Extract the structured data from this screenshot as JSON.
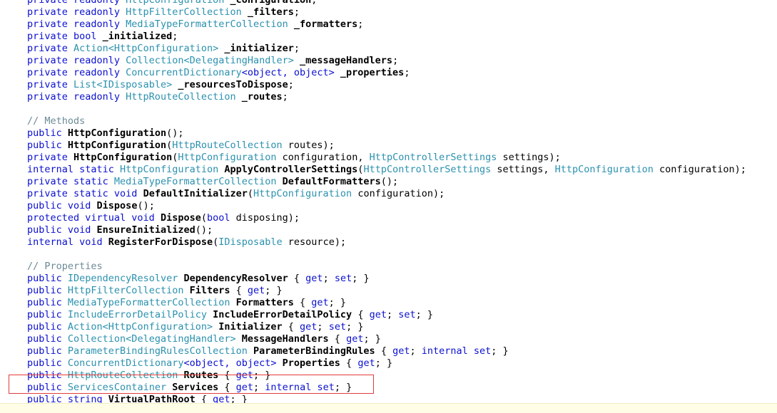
{
  "colors": {
    "keyword": "#0b10cf",
    "type": "#2b91af",
    "comment": "#6c8a96",
    "text": "#000000",
    "highlight_border": "#e23b3b",
    "status_bar": "#fffde6"
  },
  "lines": [
    [
      {
        "t": "kw",
        "v": "private readonly "
      },
      {
        "t": "type",
        "v": "HttpConfiguration "
      },
      {
        "t": "bold",
        "v": "_configuration"
      },
      {
        "t": "txt",
        "v": ";"
      }
    ],
    [
      {
        "t": "kw",
        "v": "private readonly "
      },
      {
        "t": "type",
        "v": "HttpFilterCollection "
      },
      {
        "t": "bold",
        "v": "_filters"
      },
      {
        "t": "txt",
        "v": ";"
      }
    ],
    [
      {
        "t": "kw",
        "v": "private readonly "
      },
      {
        "t": "type",
        "v": "MediaTypeFormatterCollection "
      },
      {
        "t": "bold",
        "v": "_formatters"
      },
      {
        "t": "txt",
        "v": ";"
      }
    ],
    [
      {
        "t": "kw",
        "v": "private bool "
      },
      {
        "t": "bold",
        "v": "_initialized"
      },
      {
        "t": "txt",
        "v": ";"
      }
    ],
    [
      {
        "t": "kw",
        "v": "private "
      },
      {
        "t": "type",
        "v": "Action<HttpConfiguration> "
      },
      {
        "t": "bold",
        "v": "_initializer"
      },
      {
        "t": "txt",
        "v": ";"
      }
    ],
    [
      {
        "t": "kw",
        "v": "private readonly "
      },
      {
        "t": "type",
        "v": "Collection<DelegatingHandler> "
      },
      {
        "t": "bold",
        "v": "_messageHandlers"
      },
      {
        "t": "txt",
        "v": ";"
      }
    ],
    [
      {
        "t": "kw",
        "v": "private readonly "
      },
      {
        "t": "type",
        "v": "ConcurrentDictionary"
      },
      {
        "t": "kw",
        "v": "<object, object> "
      },
      {
        "t": "bold",
        "v": "_properties"
      },
      {
        "t": "txt",
        "v": ";"
      }
    ],
    [
      {
        "t": "kw",
        "v": "private "
      },
      {
        "t": "type",
        "v": "List<IDisposable> "
      },
      {
        "t": "bold",
        "v": "_resourcesToDispose"
      },
      {
        "t": "txt",
        "v": ";"
      }
    ],
    [
      {
        "t": "kw",
        "v": "private readonly "
      },
      {
        "t": "type",
        "v": "HttpRouteCollection "
      },
      {
        "t": "bold",
        "v": "_routes"
      },
      {
        "t": "txt",
        "v": ";"
      }
    ],
    [],
    [
      {
        "t": "cm",
        "v": "// Methods"
      }
    ],
    [
      {
        "t": "kw",
        "v": "public "
      },
      {
        "t": "bold",
        "v": "HttpConfiguration"
      },
      {
        "t": "txt",
        "v": "();"
      }
    ],
    [
      {
        "t": "kw",
        "v": "public "
      },
      {
        "t": "bold",
        "v": "HttpConfiguration"
      },
      {
        "t": "txt",
        "v": "("
      },
      {
        "t": "type",
        "v": "HttpRouteCollection "
      },
      {
        "t": "txt",
        "v": "routes);"
      }
    ],
    [
      {
        "t": "kw",
        "v": "private "
      },
      {
        "t": "bold",
        "v": "HttpConfiguration"
      },
      {
        "t": "txt",
        "v": "("
      },
      {
        "t": "type",
        "v": "HttpConfiguration "
      },
      {
        "t": "txt",
        "v": "configuration, "
      },
      {
        "t": "type",
        "v": "HttpControllerSettings "
      },
      {
        "t": "txt",
        "v": "settings);"
      }
    ],
    [
      {
        "t": "kw",
        "v": "internal static "
      },
      {
        "t": "type",
        "v": "HttpConfiguration "
      },
      {
        "t": "bold",
        "v": "ApplyControllerSettings"
      },
      {
        "t": "txt",
        "v": "("
      },
      {
        "t": "type",
        "v": "HttpControllerSettings "
      },
      {
        "t": "txt",
        "v": "settings, "
      },
      {
        "t": "type",
        "v": "HttpConfiguration "
      },
      {
        "t": "txt",
        "v": "configuration);"
      }
    ],
    [
      {
        "t": "kw",
        "v": "private static "
      },
      {
        "t": "type",
        "v": "MediaTypeFormatterCollection "
      },
      {
        "t": "bold",
        "v": "DefaultFormatters"
      },
      {
        "t": "txt",
        "v": "();"
      }
    ],
    [
      {
        "t": "kw",
        "v": "private static void "
      },
      {
        "t": "bold",
        "v": "DefaultInitializer"
      },
      {
        "t": "txt",
        "v": "("
      },
      {
        "t": "type",
        "v": "HttpConfiguration "
      },
      {
        "t": "txt",
        "v": "configuration);"
      }
    ],
    [
      {
        "t": "kw",
        "v": "public void "
      },
      {
        "t": "bold",
        "v": "Dispose"
      },
      {
        "t": "txt",
        "v": "();"
      }
    ],
    [
      {
        "t": "kw",
        "v": "protected virtual void "
      },
      {
        "t": "bold",
        "v": "Dispose"
      },
      {
        "t": "txt",
        "v": "("
      },
      {
        "t": "kw",
        "v": "bool "
      },
      {
        "t": "txt",
        "v": "disposing);"
      }
    ],
    [
      {
        "t": "kw",
        "v": "public void "
      },
      {
        "t": "bold",
        "v": "EnsureInitialized"
      },
      {
        "t": "txt",
        "v": "();"
      }
    ],
    [
      {
        "t": "kw",
        "v": "internal void "
      },
      {
        "t": "bold",
        "v": "RegisterForDispose"
      },
      {
        "t": "txt",
        "v": "("
      },
      {
        "t": "type",
        "v": "IDisposable "
      },
      {
        "t": "txt",
        "v": "resource);"
      }
    ],
    [],
    [
      {
        "t": "cm",
        "v": "// Properties"
      }
    ],
    [
      {
        "t": "kw",
        "v": "public "
      },
      {
        "t": "type",
        "v": "IDependencyResolver "
      },
      {
        "t": "bold",
        "v": "DependencyResolver"
      },
      {
        "t": "txt",
        "v": " { "
      },
      {
        "t": "kw",
        "v": "get"
      },
      {
        "t": "txt",
        "v": "; "
      },
      {
        "t": "kw",
        "v": "set"
      },
      {
        "t": "txt",
        "v": "; }"
      }
    ],
    [
      {
        "t": "kw",
        "v": "public "
      },
      {
        "t": "type",
        "v": "HttpFilterCollection "
      },
      {
        "t": "bold",
        "v": "Filters"
      },
      {
        "t": "txt",
        "v": " { "
      },
      {
        "t": "kw",
        "v": "get"
      },
      {
        "t": "txt",
        "v": "; }"
      }
    ],
    [
      {
        "t": "kw",
        "v": "public "
      },
      {
        "t": "type",
        "v": "MediaTypeFormatterCollection "
      },
      {
        "t": "bold",
        "v": "Formatters"
      },
      {
        "t": "txt",
        "v": " { "
      },
      {
        "t": "kw",
        "v": "get"
      },
      {
        "t": "txt",
        "v": "; }"
      }
    ],
    [
      {
        "t": "kw",
        "v": "public "
      },
      {
        "t": "type",
        "v": "IncludeErrorDetailPolicy "
      },
      {
        "t": "bold",
        "v": "IncludeErrorDetailPolicy"
      },
      {
        "t": "txt",
        "v": " { "
      },
      {
        "t": "kw",
        "v": "get"
      },
      {
        "t": "txt",
        "v": "; "
      },
      {
        "t": "kw",
        "v": "set"
      },
      {
        "t": "txt",
        "v": "; }"
      }
    ],
    [
      {
        "t": "kw",
        "v": "public "
      },
      {
        "t": "type",
        "v": "Action<HttpConfiguration> "
      },
      {
        "t": "bold",
        "v": "Initializer"
      },
      {
        "t": "txt",
        "v": " { "
      },
      {
        "t": "kw",
        "v": "get"
      },
      {
        "t": "txt",
        "v": "; "
      },
      {
        "t": "kw",
        "v": "set"
      },
      {
        "t": "txt",
        "v": "; }"
      }
    ],
    [
      {
        "t": "kw",
        "v": "public "
      },
      {
        "t": "type",
        "v": "Collection<DelegatingHandler> "
      },
      {
        "t": "bold",
        "v": "MessageHandlers"
      },
      {
        "t": "txt",
        "v": " { "
      },
      {
        "t": "kw",
        "v": "get"
      },
      {
        "t": "txt",
        "v": "; }"
      }
    ],
    [
      {
        "t": "kw",
        "v": "public "
      },
      {
        "t": "type",
        "v": "ParameterBindingRulesCollection "
      },
      {
        "t": "bold",
        "v": "ParameterBindingRules"
      },
      {
        "t": "txt",
        "v": " { "
      },
      {
        "t": "kw",
        "v": "get"
      },
      {
        "t": "txt",
        "v": "; "
      },
      {
        "t": "kw",
        "v": "internal set"
      },
      {
        "t": "txt",
        "v": "; }"
      }
    ],
    [
      {
        "t": "kw",
        "v": "public "
      },
      {
        "t": "type",
        "v": "ConcurrentDictionary"
      },
      {
        "t": "kw",
        "v": "<object, object> "
      },
      {
        "t": "bold",
        "v": "Properties"
      },
      {
        "t": "txt",
        "v": " { "
      },
      {
        "t": "kw",
        "v": "get"
      },
      {
        "t": "txt",
        "v": "; }"
      }
    ],
    [
      {
        "t": "kw",
        "v": "public "
      },
      {
        "t": "type",
        "v": "HttpRouteCollection "
      },
      {
        "t": "bold",
        "v": "Routes"
      },
      {
        "t": "txt",
        "v": " { "
      },
      {
        "t": "kw",
        "v": "get"
      },
      {
        "t": "txt",
        "v": "; }"
      }
    ],
    [
      {
        "t": "kw",
        "v": "public "
      },
      {
        "t": "type",
        "v": "ServicesContainer "
      },
      {
        "t": "bold",
        "v": "Services"
      },
      {
        "t": "txt",
        "v": " { "
      },
      {
        "t": "kw",
        "v": "get"
      },
      {
        "t": "txt",
        "v": "; "
      },
      {
        "t": "kw",
        "v": "internal set"
      },
      {
        "t": "txt",
        "v": "; }"
      }
    ],
    [
      {
        "t": "kw",
        "v": "public string "
      },
      {
        "t": "bold",
        "v": "VirtualPathRoot"
      },
      {
        "t": "txt",
        "v": " { "
      },
      {
        "t": "kw",
        "v": "get"
      },
      {
        "t": "txt",
        "v": "; }"
      }
    ]
  ]
}
